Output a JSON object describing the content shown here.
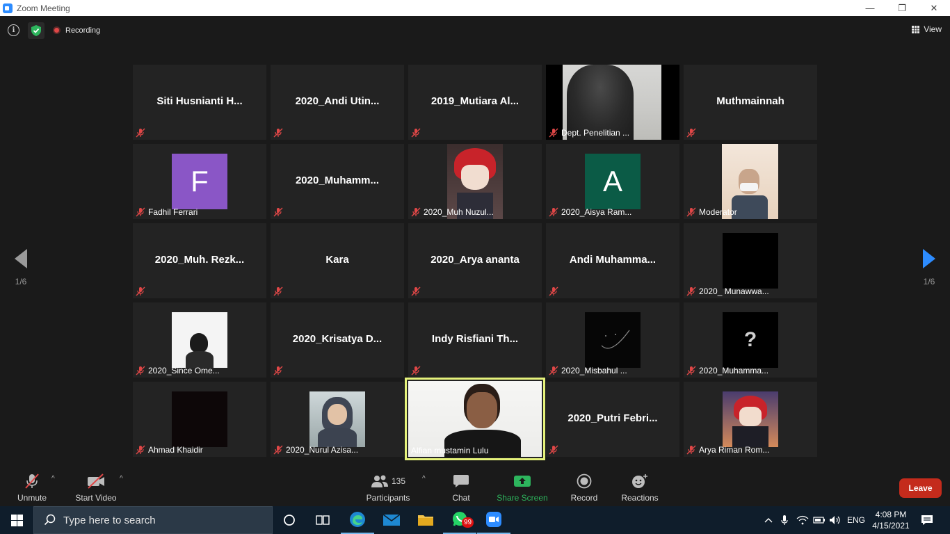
{
  "window": {
    "title": "Zoom Meeting",
    "minimize": "—",
    "maximize": "❐",
    "close": "✕"
  },
  "meeting": {
    "info_symbol": "i",
    "recording_label": "Recording",
    "view_label": "View",
    "page_indicator_left": "1/6",
    "page_indicator_right": "1/6"
  },
  "tiles": [
    {
      "name": "Siti  Husnianti  H...",
      "type": "name"
    },
    {
      "name": "2020_Andi  Utin...",
      "type": "name"
    },
    {
      "name": "2019_Mutiara  Al...",
      "type": "name"
    },
    {
      "label": "Dept. Penelitian ...",
      "type": "video"
    },
    {
      "name": "Muthmainnah",
      "type": "name"
    },
    {
      "label": "Fadhil Ferrari",
      "initial": "F",
      "type": "avatar"
    },
    {
      "name": "2020_Muhamm...",
      "type": "name"
    },
    {
      "label": "2020_Muh Nuzul...",
      "type": "picture"
    },
    {
      "label": "2020_Aisya Ram...",
      "initial": "A",
      "type": "avatar"
    },
    {
      "label": "Moderator",
      "type": "picture"
    },
    {
      "name": "2020_Muh.  Rezk...",
      "type": "name"
    },
    {
      "name": "Kara",
      "type": "name"
    },
    {
      "name": "2020_Arya ananta",
      "type": "name"
    },
    {
      "name": "Andi  Muhamma...",
      "type": "name"
    },
    {
      "label": "2020_ Munawwa...",
      "type": "picture"
    },
    {
      "label": "2020_Since Ome...",
      "type": "picture"
    },
    {
      "name": "2020_Krisatya  D...",
      "type": "name"
    },
    {
      "name": "Indy  Risfiani  Th...",
      "type": "name"
    },
    {
      "label": "2020_Misbahul ...",
      "type": "picture"
    },
    {
      "label": "2020_Muhamma...",
      "glyph": "?",
      "type": "picture"
    },
    {
      "label": "Ahmad Khaidir",
      "type": "picture"
    },
    {
      "label": "2020_Nurul Azisa...",
      "type": "picture"
    },
    {
      "label": "Alfian mustamin Lulu",
      "type": "video"
    },
    {
      "name": "2020_Putri  Febri...",
      "type": "name"
    },
    {
      "label": "Arya Riman Rom...",
      "type": "picture"
    }
  ],
  "toolbar": {
    "unmute": "Unmute",
    "start_video": "Start Video",
    "participants": "Participants",
    "participant_count": "135",
    "chat": "Chat",
    "share_screen": "Share Screen",
    "record": "Record",
    "reactions": "Reactions",
    "leave": "Leave"
  },
  "taskbar": {
    "search_placeholder": "Type here to search",
    "whatsapp_badge": "99",
    "language": "ENG",
    "time": "4:08 PM",
    "date": "4/15/2021"
  },
  "colors": {
    "accent": "#2d8cff",
    "share_green": "#2db55d",
    "leave_red": "#c42b1c",
    "active_speaker": "#e5f27b",
    "muted_red": "#e04747"
  }
}
